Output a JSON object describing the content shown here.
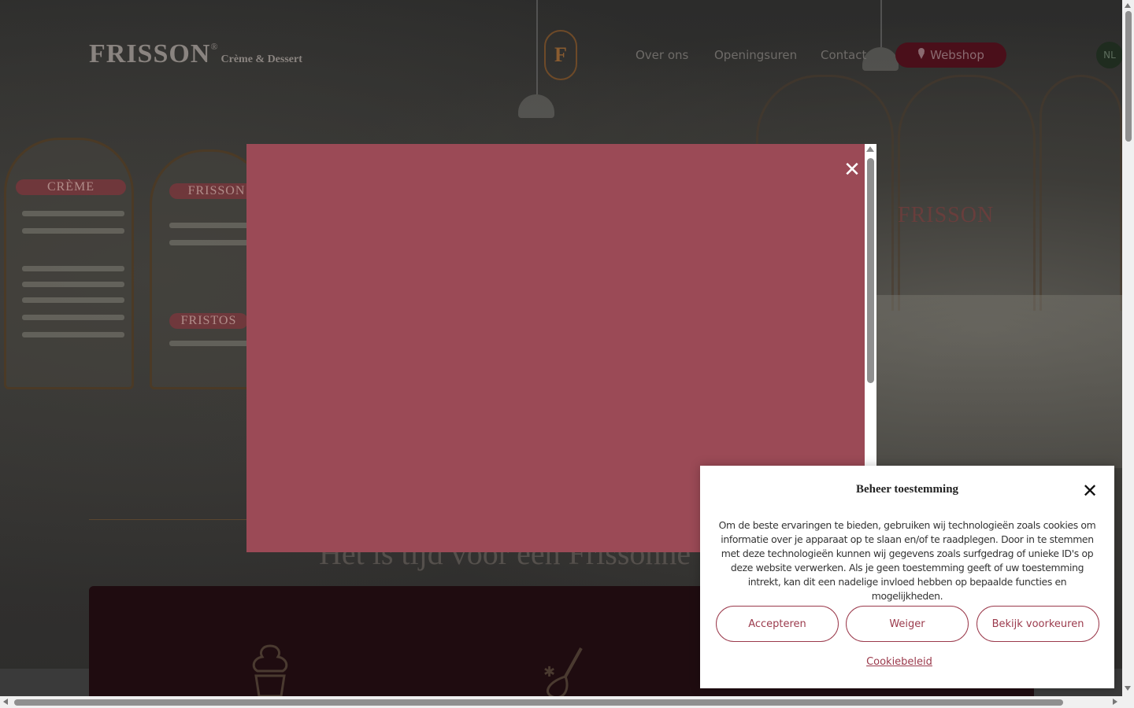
{
  "header": {
    "logo_main": "FRISSON",
    "logo_reg": "®",
    "logo_sub": "Crème & Dessert",
    "emblem_letter": "F",
    "nav": [
      "Over ons",
      "Openingsuren",
      "Contact"
    ],
    "webshop_label": "Webshop",
    "webshop_icon": "ice-cream-icon",
    "language": "NL"
  },
  "hero": {
    "boards": [
      "CRÈME",
      "FRISSON",
      "FRISTOS"
    ],
    "shop_sign": "FRISSON",
    "title": "Het is tijd voor een Frissonne"
  },
  "modal": {
    "close_glyph": "✕",
    "background_color": "#9b4a56"
  },
  "cookie": {
    "title": "Beheer toestemming",
    "close_glyph": "✕",
    "text": "Om de beste ervaringen te bieden, gebruiken wij technologieën zoals cookies om informatie over je apparaat op te slaan en/of te raadplegen. Door in te stemmen met deze technologieën kunnen wij gegevens zoals surfgedrag of unieke ID's op deze website verwerken. Als je geen toestemming geeft of uw toestemming intrekt, kan dit een nadelige invloed hebben op bepaalde functies en mogelijkheden.",
    "buttons": {
      "accept": "Accepteren",
      "deny": "Weiger",
      "preferences": "Bekijk voorkeuren"
    },
    "policy_link": "Cookiebeleid",
    "accent_color": "#9b3a4c"
  }
}
